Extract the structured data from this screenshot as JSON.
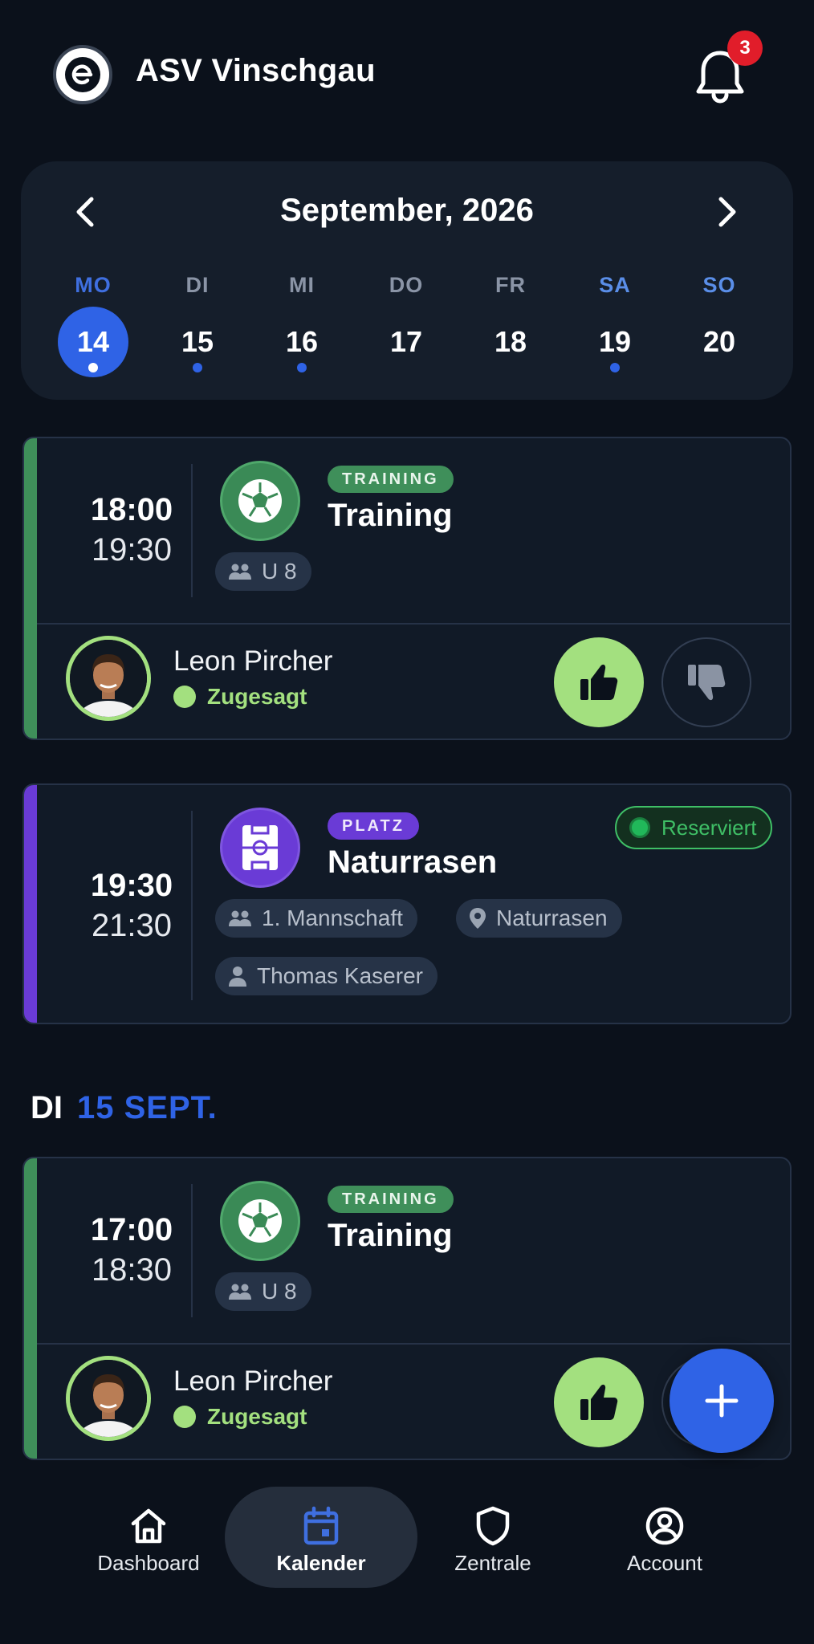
{
  "header": {
    "club_name": "ASV Vinschgau",
    "notifications_count": "3"
  },
  "calendar": {
    "month_label": "September, 2026",
    "days": [
      {
        "name": "MO",
        "num": "14",
        "active": true,
        "dot": true
      },
      {
        "name": "DI",
        "num": "15",
        "active": false,
        "dot": true
      },
      {
        "name": "MI",
        "num": "16",
        "active": false,
        "dot": true
      },
      {
        "name": "DO",
        "num": "17",
        "active": false,
        "dot": false
      },
      {
        "name": "FR",
        "num": "18",
        "active": false,
        "dot": false
      },
      {
        "name": "SA",
        "num": "19",
        "active": false,
        "dot": true
      },
      {
        "name": "SO",
        "num": "20",
        "active": false,
        "dot": false
      }
    ]
  },
  "events": [
    {
      "start": "18:00",
      "end": "19:30",
      "type": "TRAINING",
      "title": "Training",
      "team": "U 8",
      "person": "Leon Pircher",
      "status": "Zugesagt"
    },
    {
      "start": "19:30",
      "end": "21:30",
      "type": "PLATZ",
      "title": "Naturrasen",
      "reservation": "Reserviert",
      "team": "1. Mannschaft",
      "location": "Naturrasen",
      "contact": "Thomas Kaserer"
    }
  ],
  "day2": {
    "weekday": "DI",
    "date": "15 SEPT.",
    "events": [
      {
        "start": "17:00",
        "end": "18:30",
        "type": "TRAINING",
        "title": "Training",
        "team": "U 8",
        "person": "Leon Pircher",
        "status": "Zugesagt"
      }
    ]
  },
  "nav": [
    {
      "label": "Dashboard",
      "icon": "home-icon"
    },
    {
      "label": "Kalender",
      "icon": "calendar-icon",
      "active": true
    },
    {
      "label": "Zentrale",
      "icon": "shield-icon"
    },
    {
      "label": "Account",
      "icon": "account-icon"
    }
  ],
  "colors": {
    "accent": "#2f63e6",
    "training_green": "#3f8f5a",
    "platz_purple": "#6a3bd6",
    "confirm_green": "#a3e07f",
    "background": "#0b111b"
  }
}
